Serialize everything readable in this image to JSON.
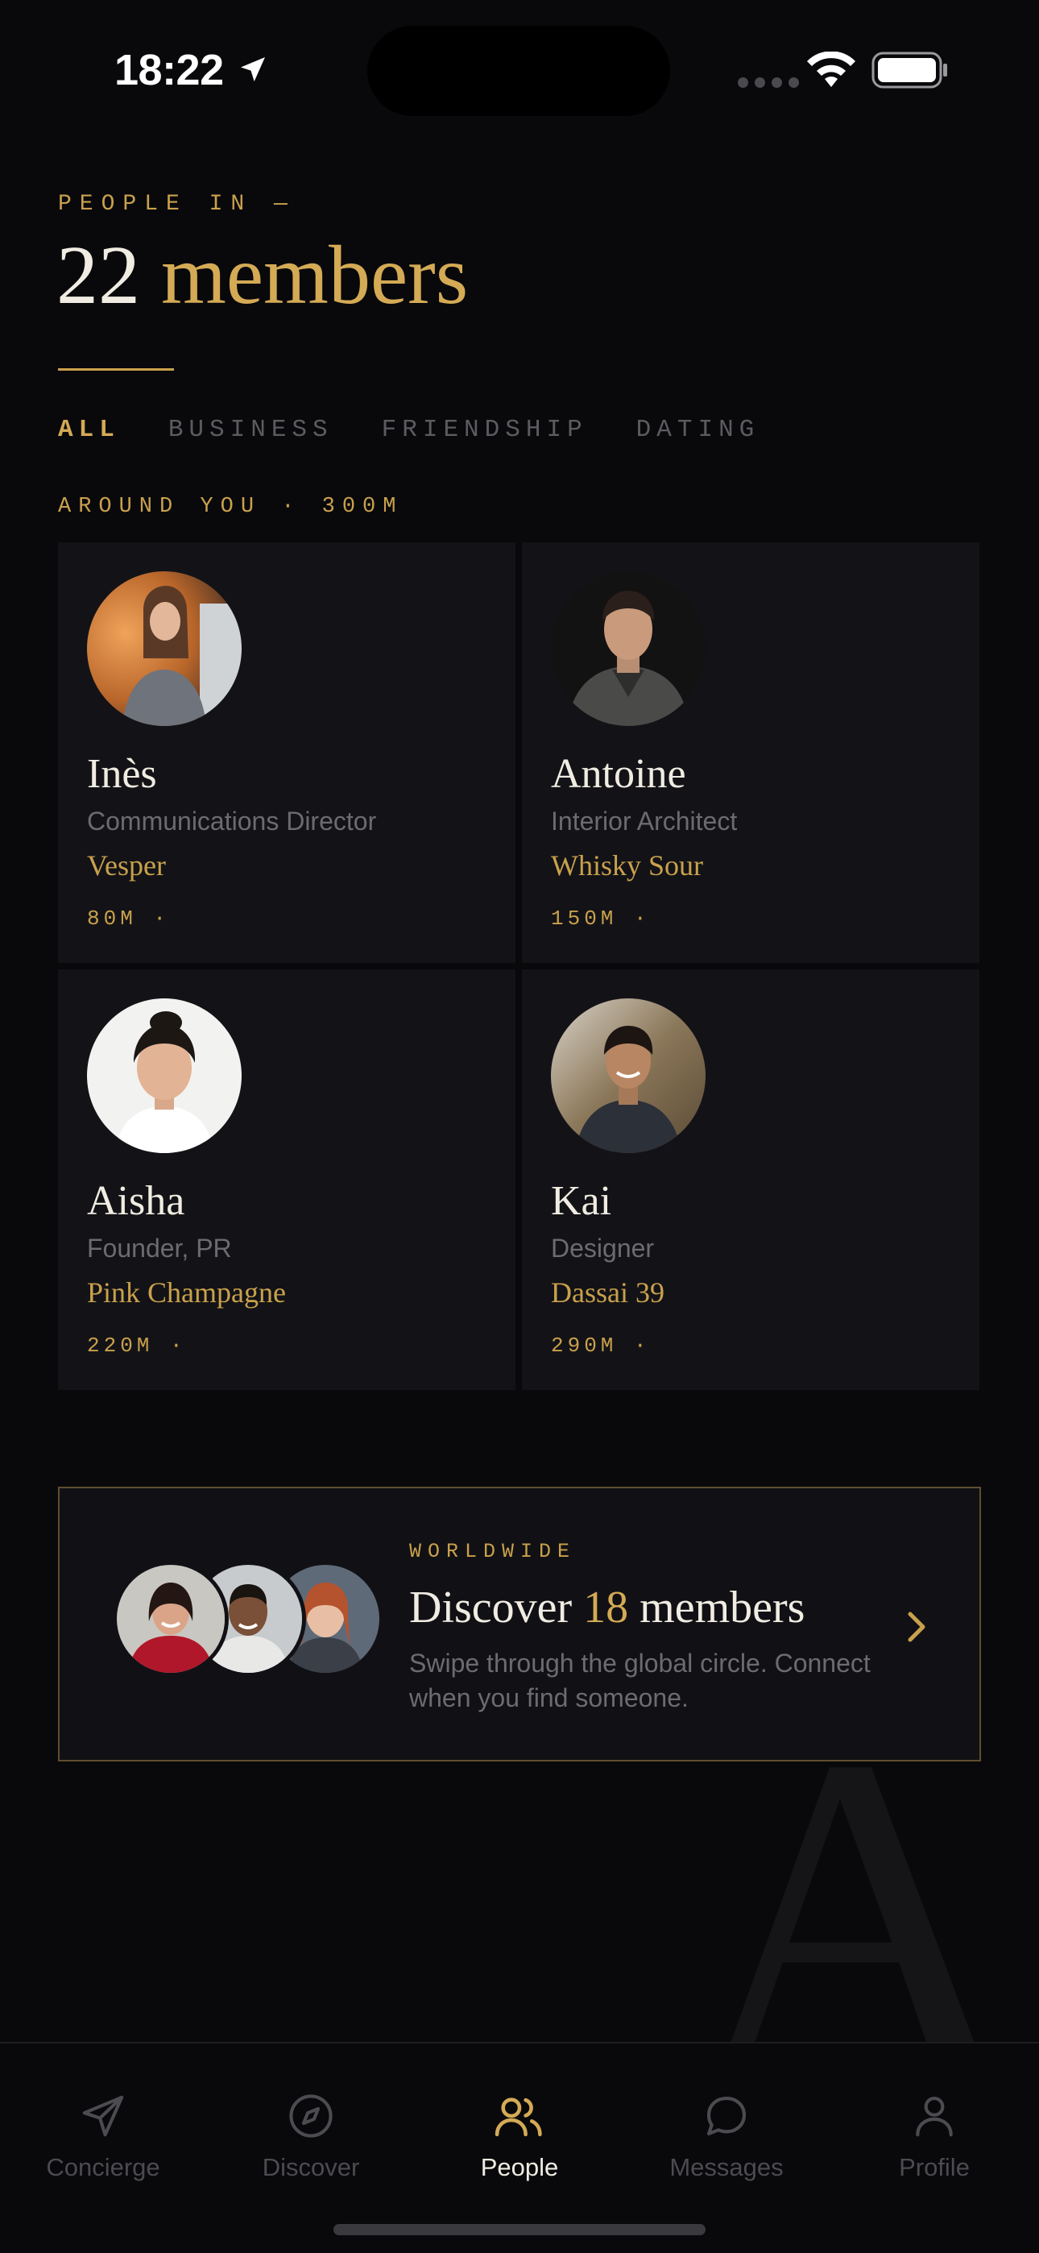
{
  "status_bar": {
    "time": "18:22"
  },
  "header": {
    "eyebrow": "PEOPLE IN —",
    "count": "22",
    "count_label": "members"
  },
  "tabs": [
    {
      "label": "ALL",
      "active": true
    },
    {
      "label": "BUSINESS",
      "active": false
    },
    {
      "label": "FRIENDSHIP",
      "active": false
    },
    {
      "label": "DATING",
      "active": false
    }
  ],
  "section_label": "AROUND YOU · 300M",
  "people": [
    {
      "name": "Inès",
      "role": "Communications Director",
      "drink": "Vesper",
      "distance": "80M ·"
    },
    {
      "name": "Antoine",
      "role": "Interior Architect",
      "drink": "Whisky Sour",
      "distance": "150M ·"
    },
    {
      "name": "Aisha",
      "role": "Founder, PR",
      "drink": "Pink Champagne",
      "distance": "220M ·"
    },
    {
      "name": "Kai",
      "role": "Designer",
      "drink": "Dassai 39",
      "distance": "290M ·"
    }
  ],
  "discover_card": {
    "eyebrow": "WORLDWIDE",
    "title_prefix": "Discover",
    "count": "18",
    "title_suffix": "members",
    "subtitle": "Swipe through the global circle. Connect when you find someone."
  },
  "background_letter": "A",
  "tabbar": [
    {
      "label": "Concierge",
      "icon": "paper-plane-icon",
      "active": false
    },
    {
      "label": "Discover",
      "icon": "compass-icon",
      "active": false
    },
    {
      "label": "People",
      "icon": "people-icon",
      "active": true
    },
    {
      "label": "Messages",
      "icon": "chat-bubble-icon",
      "active": false
    },
    {
      "label": "Profile",
      "icon": "person-icon",
      "active": false
    }
  ],
  "colors": {
    "background": "#09090c",
    "card": "#131317",
    "gold": "#c9a14c",
    "text": "#f0ece2",
    "muted": "#6b6b70"
  }
}
